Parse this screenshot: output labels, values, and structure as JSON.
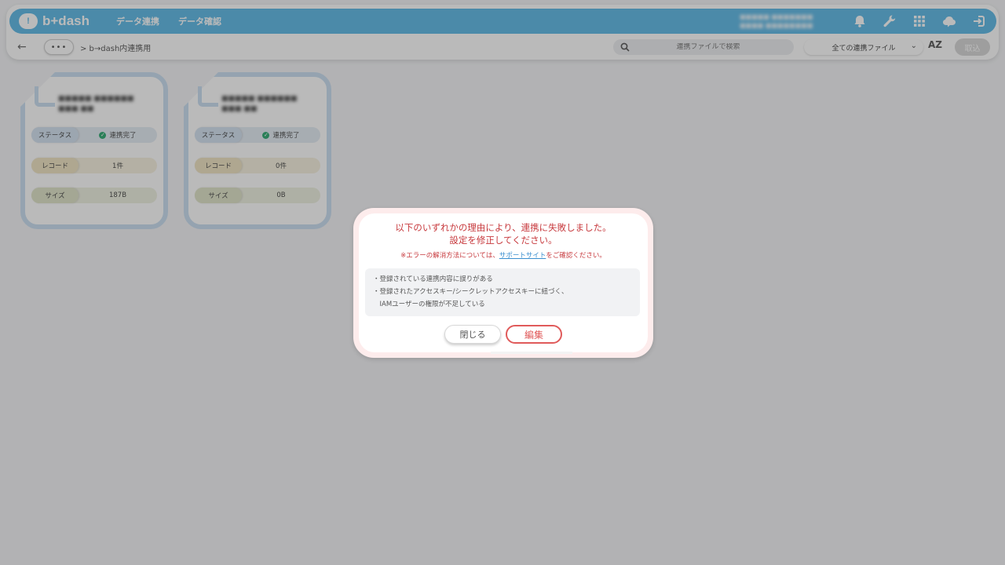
{
  "app": {
    "logo_text": "b+dash",
    "logo_mark": "!"
  },
  "header": {
    "nav": [
      "データ連携",
      "データ確認"
    ],
    "user_line1": "■■■■■ ■■■■■■■",
    "user_line2": "■■■■ ■■■■■■■■",
    "icons": [
      "bell-icon",
      "wrench-icon",
      "grid-icon",
      "chat-cloud-icon",
      "logout-icon"
    ],
    "accent_color": "#5cb8e6"
  },
  "subbar": {
    "back": "←",
    "more": "•••",
    "breadcrumb": "> b→dash内連携用",
    "search_placeholder": "連携ファイルで検索",
    "filter_value": "全ての連携ファイル",
    "sort_label": "AZ",
    "capture_label": "取込"
  },
  "cards": [
    {
      "title": "■■■■■ ■■■■■■ ■■■ ■■",
      "status_label": "ステータス",
      "status_value": "連携完了",
      "record_label": "レコード",
      "record_value": "1件",
      "size_label": "サイズ",
      "size_value": "187B"
    },
    {
      "title": "■■■■■ ■■■■■■ ■■■ ■■",
      "status_label": "ステータス",
      "status_value": "連携完了",
      "record_label": "レコード",
      "record_value": "0件",
      "size_label": "サイズ",
      "size_value": "0B"
    }
  ],
  "modal": {
    "title_line1": "以下のいずれかの理由により、連携に失敗しました。",
    "title_line2": "設定を修正してください。",
    "note_prefix": "※エラーの解消方法については、",
    "note_link": "サポートサイト",
    "note_suffix": "をご確認ください。",
    "reasons": [
      "・登録されている連携内容に誤りがある",
      "・登録されたアクセスキー/シークレットアクセスキーに紐づく、",
      "　IAMユーザーの権限が不足している"
    ],
    "close_label": "閉じる",
    "edit_label": "編集",
    "error_color": "#c7393d"
  }
}
